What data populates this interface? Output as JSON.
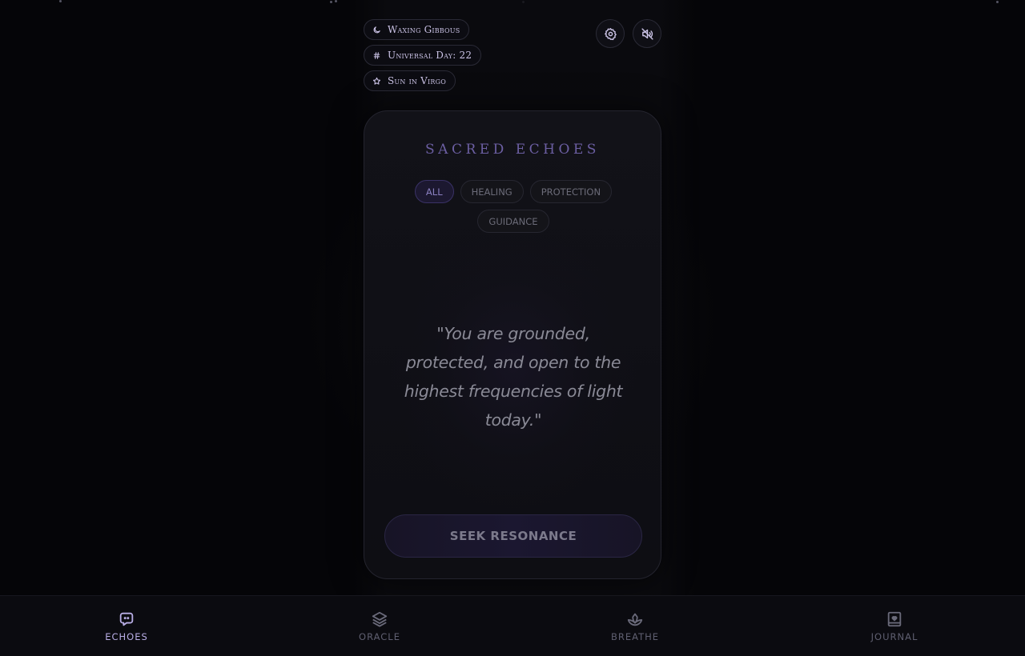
{
  "header": {
    "chips": [
      {
        "icon": "moon-icon",
        "label": "Waxing Gibbous"
      },
      {
        "icon": "hash-icon",
        "label": "Universal Day: 22"
      },
      {
        "icon": "star-icon",
        "label": "Sun in Virgo"
      }
    ],
    "buttons": [
      {
        "icon": "settings-icon"
      },
      {
        "icon": "sound-off-icon"
      }
    ]
  },
  "card": {
    "title": "SACRED ECHOES",
    "filters": [
      {
        "label": "ALL",
        "active": true
      },
      {
        "label": "HEALING",
        "active": false
      },
      {
        "label": "PROTECTION",
        "active": false
      },
      {
        "label": "GUIDANCE",
        "active": false
      }
    ],
    "quote": "\"You are grounded, protected, and open to the highest frequencies of light today.\"",
    "action_label": "SEEK RESONANCE"
  },
  "nav": {
    "items": [
      {
        "icon": "chat-icon",
        "label": "ECHOES",
        "active": true
      },
      {
        "icon": "layers-icon",
        "label": "ORACLE",
        "active": false
      },
      {
        "icon": "lotus-icon",
        "label": "BREATHE",
        "active": false
      },
      {
        "icon": "journal-icon",
        "label": "JOURNAL",
        "active": false
      }
    ]
  },
  "colors": {
    "accent": "#b9aee6",
    "background": "#050508",
    "card": "#121218",
    "muted": "#5f5f70"
  }
}
